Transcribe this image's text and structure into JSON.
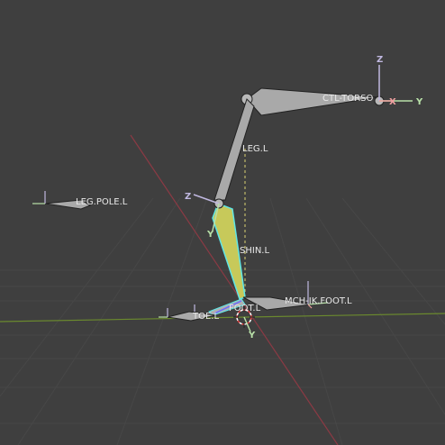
{
  "viewport": {
    "bones": [
      {
        "id": "ctl-torso",
        "label": "CTL-TORSO"
      },
      {
        "id": "leg",
        "label": "LEG.L"
      },
      {
        "id": "leg-pole",
        "label": "LEG.POLE.L"
      },
      {
        "id": "shin",
        "label": "SHIN.L"
      },
      {
        "id": "mch-ik-foot",
        "label": "MCH-IK.FOOT.L"
      },
      {
        "id": "foot",
        "label": "FOOT.L"
      },
      {
        "id": "toe",
        "label": "TOE.L"
      }
    ],
    "gizmo_axes": {
      "x": "X",
      "y": "Y",
      "z": "Z"
    },
    "colors": {
      "background": "#3f3f3f",
      "grid": "#4a4a4a",
      "x_axis": "#8b3a44",
      "y_axis": "#6b8a2e",
      "bone": "#a9a9a9",
      "selected_bone_fill": "#c7c95a",
      "selected_bone_outline": "#5fe6e6",
      "gizmo_z": "#c0b8e0",
      "gizmo_y": "#b8e0a8",
      "gizmo_x": "#f0a0a0",
      "cursor": "#e04040"
    }
  }
}
